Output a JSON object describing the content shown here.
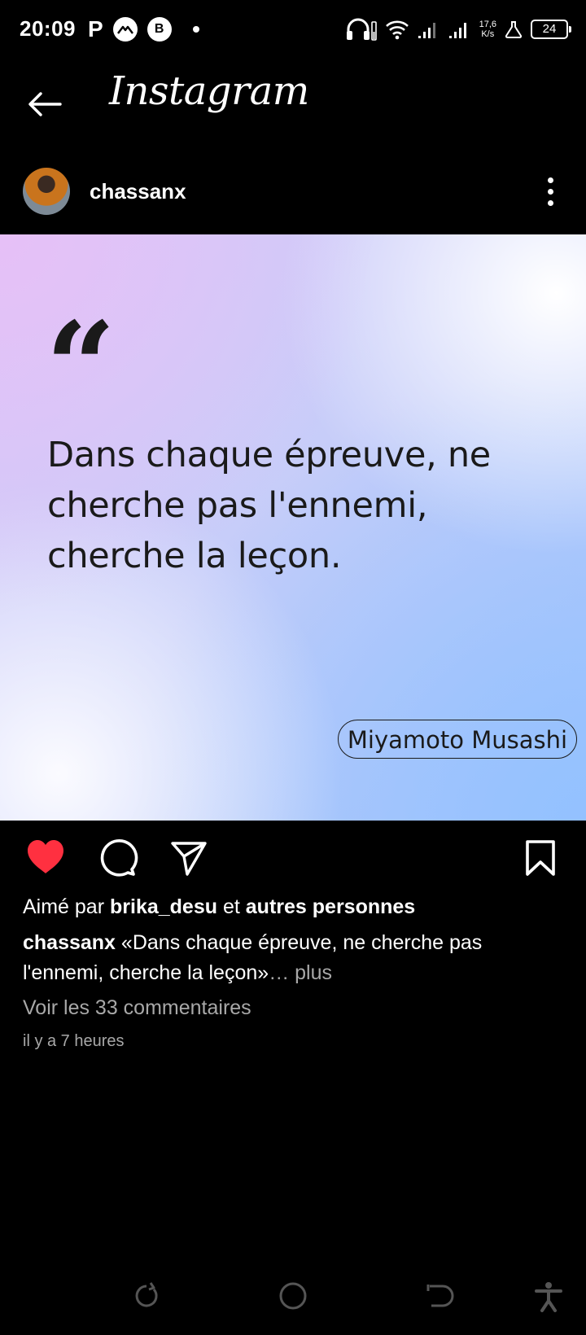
{
  "status_bar": {
    "time": "20:09",
    "left_icons": [
      "p-icon",
      "ufo-icon",
      "b-icon",
      "dot"
    ],
    "p_label": "P",
    "b_label": "B",
    "net_speed_value": "17,6",
    "net_speed_unit": "K/s",
    "battery": "24"
  },
  "app_bar": {
    "title": "Instagram"
  },
  "post": {
    "username": "chassanx",
    "quote_mark": "“",
    "quote": "Dans chaque épreuve, ne cherche pas l'ennemi, cherche la leçon.",
    "author": "Miyamoto Musashi",
    "liked": true,
    "colors": {
      "heart": "#ff3040",
      "text_dark": "#1a1a1a"
    }
  },
  "engagement": {
    "liked_by_prefix": "Aimé par",
    "liked_by_user": "brika_desu",
    "liked_by_joiner": "et",
    "liked_by_others": "autres personnes",
    "caption_user": "chassanx",
    "caption_text": "«Dans chaque épreuve, ne cherche pas l'ennemi, cherche la leçon»",
    "caption_more": "… plus",
    "view_comments": "Voir les 33 commentaires",
    "time_ago": "il y a 7 heures"
  }
}
